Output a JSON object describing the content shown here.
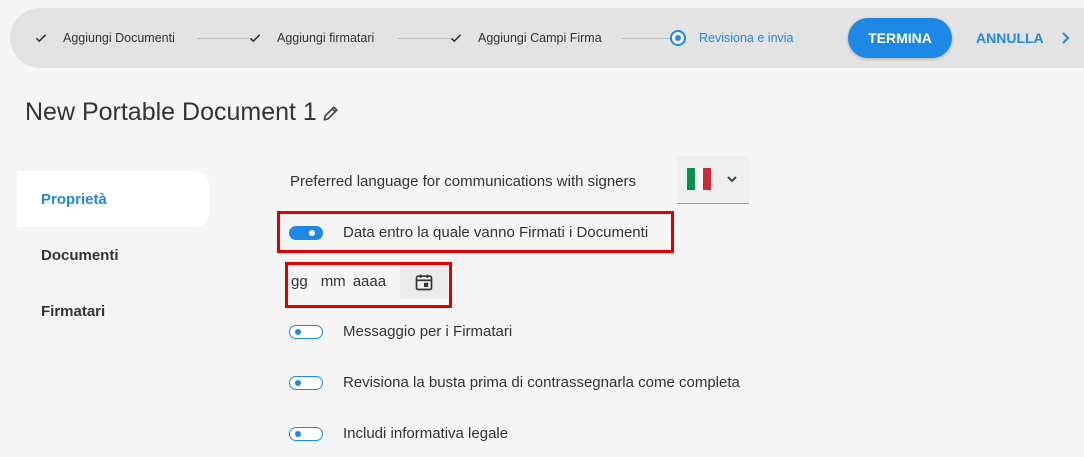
{
  "stepper": {
    "steps": [
      {
        "label": "Aggiungi Documenti",
        "state": "done"
      },
      {
        "label": "Aggiungi firmatari",
        "state": "done"
      },
      {
        "label": "Aggiungi Campi Firma",
        "state": "done"
      },
      {
        "label": "Revisiona e invia",
        "state": "current"
      }
    ],
    "primary_button": "TERMINA",
    "cancel_button": "ANNULLA"
  },
  "document_title": "New Portable Document 1",
  "sidebar": {
    "items": [
      {
        "label": "Proprietà",
        "active": true
      },
      {
        "label": "Documenti",
        "active": false
      },
      {
        "label": "Firmatari",
        "active": false
      }
    ]
  },
  "properties": {
    "language_label": "Preferred language for communications with signers",
    "language_flag": "italy-flag-icon",
    "deadline": {
      "label": "Data entro la quale vanno Firmati i Documenti",
      "enabled": true
    },
    "date_input": {
      "day": "gg",
      "month": "mm",
      "year": "aaaa"
    },
    "message": {
      "label": "Messaggio per i Firmatari",
      "enabled": false
    },
    "review": {
      "label": "Revisiona la busta prima di contrassegnarla come completa",
      "enabled": false
    },
    "legal": {
      "label": "Includi informativa legale",
      "enabled": false
    }
  },
  "colors": {
    "accent": "#1e88e5",
    "highlight": "#e00000",
    "flag_green": "#009246",
    "flag_white": "#ffffff",
    "flag_red": "#ce2b37"
  }
}
